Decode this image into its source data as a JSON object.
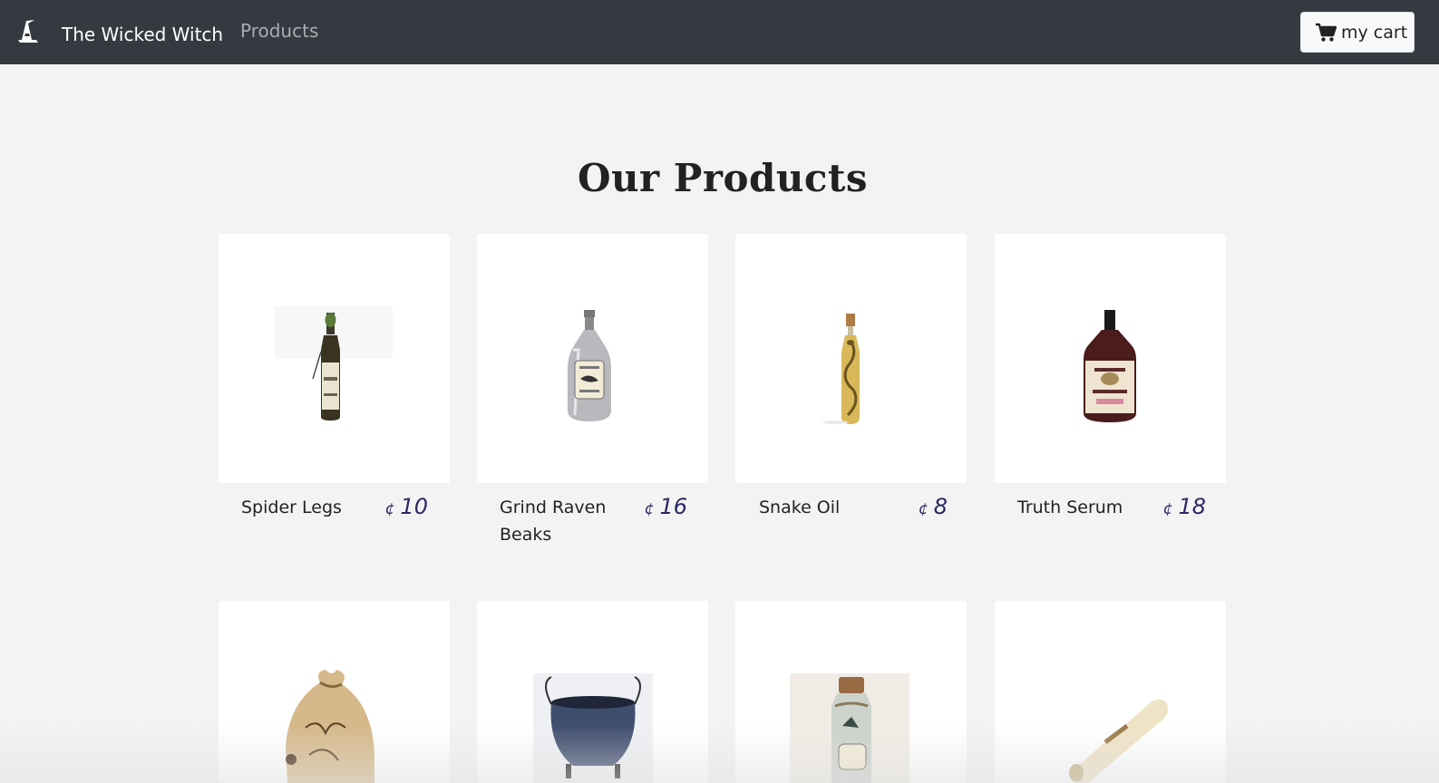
{
  "navbar": {
    "logo_icon": "witch-hat-icon",
    "brand": "The Wicked Witch",
    "nav_link": "Products",
    "cart": {
      "icon": "cart-icon",
      "label": "my cart"
    }
  },
  "page_title": "Our Products",
  "currency_symbol": "¢",
  "products": [
    {
      "name": "Spider Legs",
      "price": "10",
      "image": "potion-bottle-green-cap"
    },
    {
      "name": "Grind Raven Beaks",
      "price": "16",
      "image": "silver-raven-bottle"
    },
    {
      "name": "Snake Oil",
      "price": "8",
      "image": "snake-bottle"
    },
    {
      "name": "Truth Serum",
      "price": "18",
      "image": "truth-serum-bottle"
    },
    {
      "name": "",
      "price": "",
      "image": "magic-beans-sack"
    },
    {
      "name": "",
      "price": "",
      "image": "iron-cauldron"
    },
    {
      "name": "",
      "price": "",
      "image": "dragon-scales-jar"
    },
    {
      "name": "",
      "price": "",
      "image": "parchment-scroll"
    }
  ]
}
